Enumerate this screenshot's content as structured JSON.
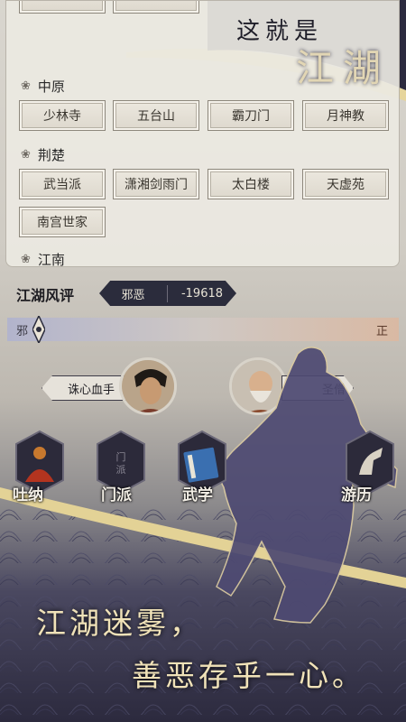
{
  "header": {
    "line1": "这就是",
    "line2": "江湖"
  },
  "regions": [
    {
      "name": "中原",
      "sects": [
        "少林寺",
        "五台山",
        "霸刀门",
        "月神教"
      ]
    },
    {
      "name": "荆楚",
      "sects": [
        "武当派",
        "潇湘剑雨门",
        "太白楼",
        "天虚苑",
        "南宫世家"
      ]
    },
    {
      "name": "江南",
      "sects": []
    }
  ],
  "reputation": {
    "label": "江湖风评",
    "name": "邪恶",
    "value": "-19618"
  },
  "moral_bar": {
    "left": "邪",
    "right": "正",
    "level": 0.08
  },
  "titles": {
    "left": "诛心血手",
    "right": "圣僧"
  },
  "menu": [
    {
      "label": "吐纳",
      "icon": "meditation-icon"
    },
    {
      "label": "门派",
      "icon": "sect-icon"
    },
    {
      "label": "武学",
      "icon": "martial-book-icon"
    },
    {
      "label": "游历",
      "icon": "travel-icon"
    }
  ],
  "slogan": {
    "line1": "江湖迷雾，",
    "line2": "善恶存乎一心。"
  },
  "colors": {
    "panel": "#ece9e2",
    "navy": "#2b2c3c",
    "gold": "#e2cf95"
  }
}
